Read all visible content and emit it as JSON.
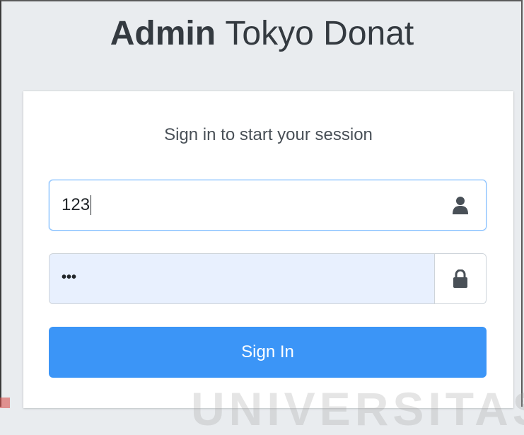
{
  "logo": {
    "bold": "Admin",
    "light": "Tokyo Donat"
  },
  "card": {
    "message": "Sign in to start your session"
  },
  "form": {
    "username_value": "123",
    "password_masked": "•••",
    "username_icon": "user-icon",
    "password_icon": "lock-icon",
    "submit_label": "Sign In"
  },
  "watermark": "UNIVERSITAS",
  "colors": {
    "background": "#e9ecef",
    "primary": "#3b95f7",
    "autofill": "#e8f0fe",
    "focus_border": "#80bdff"
  }
}
